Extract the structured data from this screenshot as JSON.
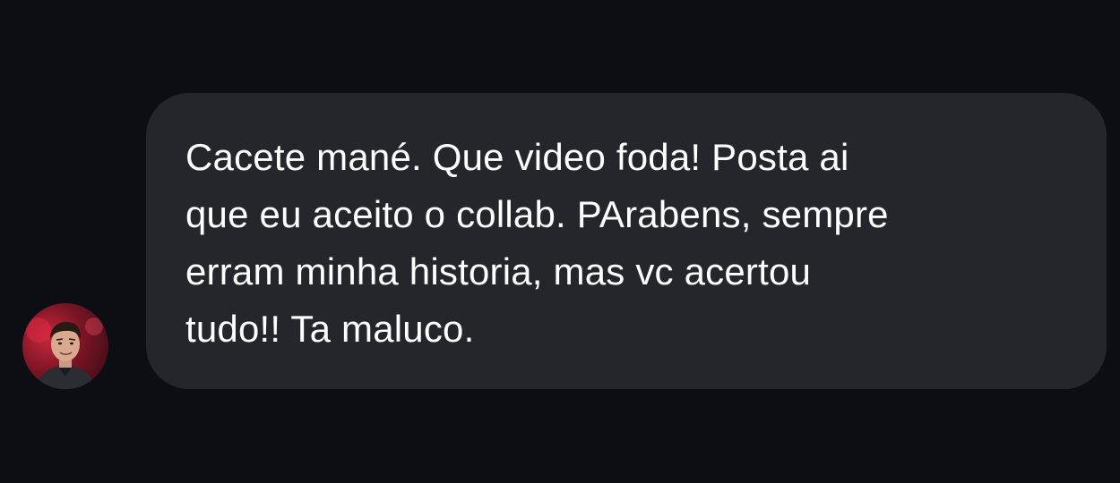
{
  "message": {
    "sender_avatar_icon": "user-avatar-photo",
    "lines": [
      "Cacete mané. Que video foda! Posta ai",
      "que eu aceito o collab. PArabens, sempre",
      "erram minha historia, mas vc acertou",
      "tudo!! Ta maluco."
    ]
  },
  "colors": {
    "background": "#0c0e13",
    "bubble": "#25262b",
    "text": "#ffffff"
  }
}
